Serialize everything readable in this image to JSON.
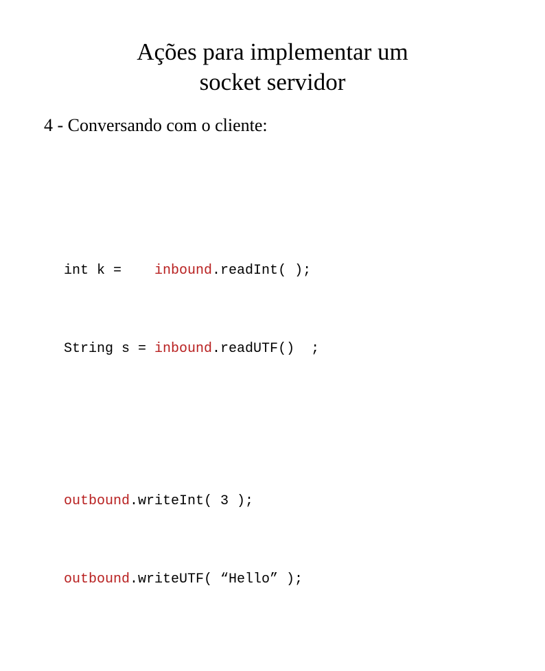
{
  "slide": {
    "background_color": "#ffffff",
    "title": {
      "lines": [
        "Ações para implementar um",
        "socket servidor"
      ]
    },
    "subtitle": "4 - Conversando com o cliente:",
    "code": {
      "accent_color": "#b82020",
      "text_color": "#000000",
      "lines": [
        {
          "id": "line-read-int",
          "segments": [
            {
              "text": "int k =    ",
              "color": "black"
            },
            {
              "text": "inbound",
              "color": "red"
            },
            {
              "text": ".readInt( );",
              "color": "black"
            }
          ],
          "plain": "int k =    inbound.readInt( );"
        },
        {
          "id": "line-read-utf",
          "segments": [
            {
              "text": "String s = ",
              "color": "black"
            },
            {
              "text": "inbound",
              "color": "red"
            },
            {
              "text": ".readUTF()  ;",
              "color": "black"
            }
          ],
          "plain": "String s = inbound.readUTF()  ;"
        },
        {
          "id": "line-blank",
          "segments": [],
          "plain": ""
        },
        {
          "id": "line-write-int",
          "segments": [
            {
              "text": "outbound",
              "color": "red"
            },
            {
              "text": ".writeInt( 3 );",
              "color": "black"
            }
          ],
          "plain": "outbound.writeInt( 3 );"
        },
        {
          "id": "line-write-utf",
          "segments": [
            {
              "text": "outbound",
              "color": "red"
            },
            {
              "text": ".writeUTF( “Hello” );",
              "color": "black"
            }
          ],
          "plain": "outbound.writeUTF( “Hello” );"
        }
      ]
    }
  }
}
